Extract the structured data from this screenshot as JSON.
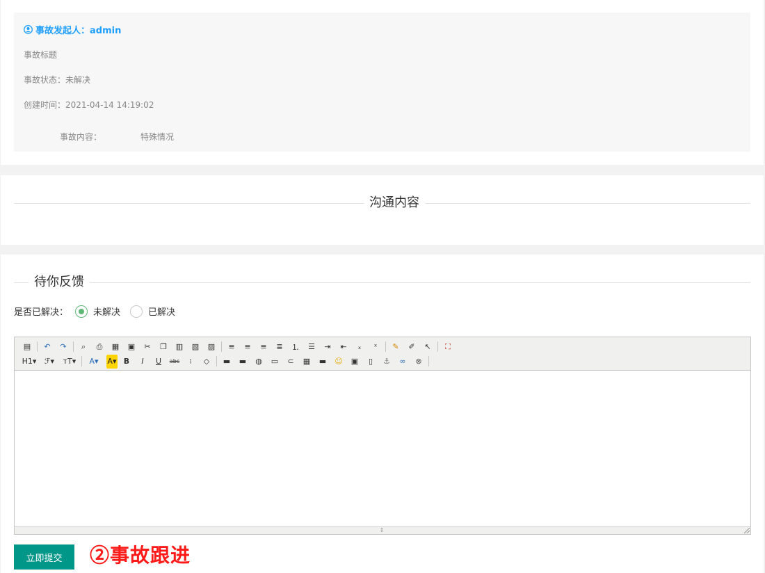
{
  "incident": {
    "initiator_label": "事故发起人：admin",
    "title_label": "事故标题",
    "status_label": "事故状态：未解决",
    "created_label": "创建时间：2021-04-14 14:19:02",
    "content_label": "事故内容：",
    "content_value": "特殊情况"
  },
  "communication": {
    "heading": "沟通内容"
  },
  "feedback": {
    "heading": "待你反馈",
    "resolved_question": "是否已解决：",
    "options": [
      {
        "label": "未解决",
        "checked": true
      },
      {
        "label": "已解决",
        "checked": false
      }
    ],
    "toolbar": {
      "row1": [
        "source-icon",
        "undo-icon",
        "redo-icon",
        "preview-icon",
        "print-icon",
        "template-icon",
        "snapscreen-icon",
        "cut-icon",
        "copy-icon",
        "paste-icon",
        "paste-text-icon",
        "paste-word-icon",
        "align-left-icon",
        "align-center-icon",
        "align-right-icon",
        "align-justify-icon",
        "ordered-list-icon",
        "unordered-list-icon",
        "indent-icon",
        "outdent-icon",
        "subscript-icon",
        "superscript-icon",
        "format-painter-icon",
        "clear-format-icon",
        "select-all-icon",
        "fullscreen-icon"
      ],
      "row2": [
        "heading-icon",
        "font-family-icon",
        "font-size-icon",
        "font-color-icon",
        "highlight-icon",
        "bold-icon",
        "italic-icon",
        "underline-icon",
        "strikethrough-icon",
        "line-height-icon",
        "eraser-icon",
        "image-icon",
        "multi-image-icon",
        "flash-icon",
        "media-icon",
        "attachment-icon",
        "table-icon",
        "hr-icon",
        "emoticon-icon",
        "image-manager-icon",
        "pagebreak-icon",
        "anchor-icon",
        "link-icon",
        "unlink-icon"
      ]
    },
    "submit_label": "立即提交"
  },
  "annotation": {
    "text": "②事故跟进",
    "color": "#ff1a1a"
  },
  "colors": {
    "accent_blue": "#1e9fff",
    "submit_green": "#009688",
    "radio_green": "#5fb878"
  }
}
